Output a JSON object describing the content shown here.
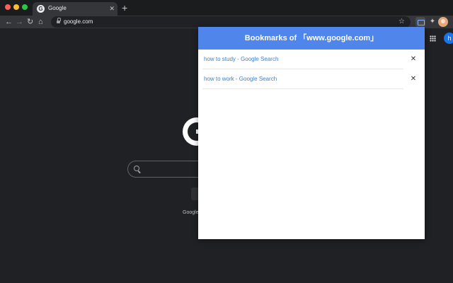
{
  "browser": {
    "tab": {
      "title": "Google",
      "favicon": "G"
    },
    "new_tab": "+",
    "address": {
      "url": "google.com"
    },
    "nav": {
      "back": "←",
      "forward": "→",
      "reload": "↻",
      "home": "⌂"
    },
    "star": "☆",
    "extensions_icon": "✦",
    "tab_close": "✕"
  },
  "page": {
    "offered_in": "Google",
    "profile_initial": "h"
  },
  "popup": {
    "title": "Bookmarks of 「www.google.com」",
    "bookmarks": [
      {
        "label": "how to study - Google Search",
        "remove": "✕"
      },
      {
        "label": "how to work - Google Search",
        "remove": "✕"
      }
    ]
  },
  "colors": {
    "popup_header": "#5086ec",
    "link": "#3c7fd6",
    "page_background": "#202124"
  }
}
